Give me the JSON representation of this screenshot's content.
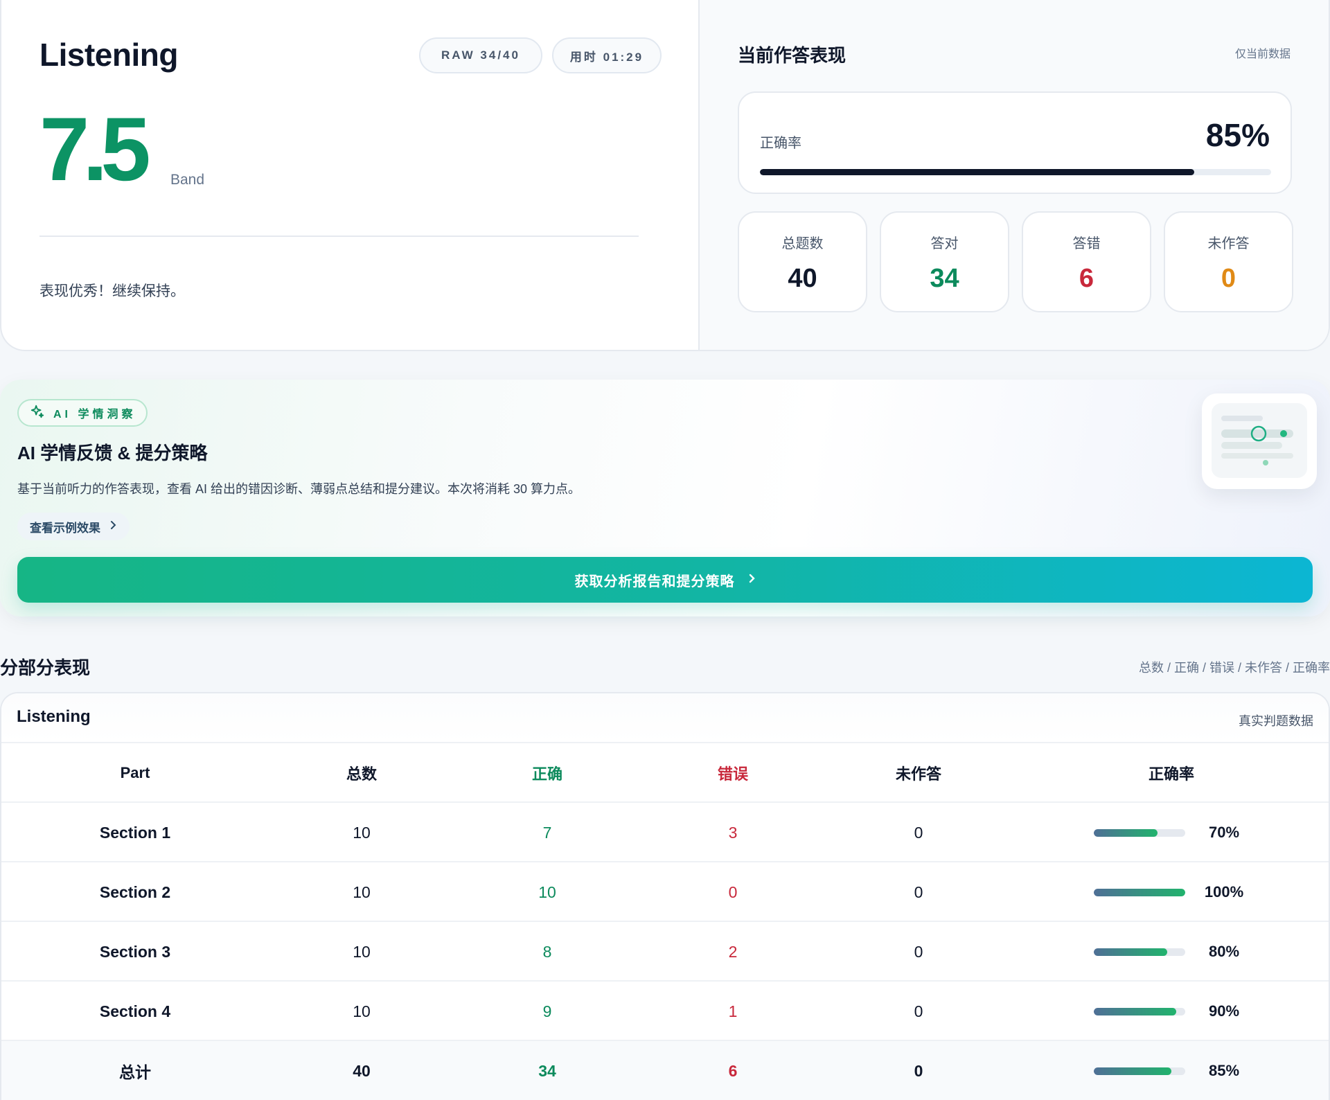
{
  "summary": {
    "module_title": "Listening",
    "raw_pill": "RAW 34/40",
    "time_pill": "用时 01:29",
    "band_score": "7.5",
    "band_label": "Band",
    "comment": "表现优秀！继续保持。"
  },
  "performance": {
    "title": "当前作答表现",
    "note": "仅当前数据",
    "accuracy_label": "正确率",
    "accuracy_text": "85%",
    "accuracy_fraction": 0.85,
    "stats": [
      {
        "label": "总题数",
        "value": "40",
        "color": "#0f172a"
      },
      {
        "label": "答对",
        "value": "34",
        "color": "#0c8a5c"
      },
      {
        "label": "答错",
        "value": "6",
        "color": "#c8283b"
      },
      {
        "label": "未作答",
        "value": "0",
        "color": "#e08a16"
      }
    ]
  },
  "ai": {
    "tag": "AI 学情洞察",
    "title": "AI 学情反馈 & 提分策略",
    "description": "基于当前听力的作答表现，查看 AI 给出的错因诊断、薄弱点总结和提分建议。本次将消耗 30 算力点。",
    "example_label": "查看示例效果",
    "cta_label": "获取分析报告和提分策略"
  },
  "sections": {
    "title": "分部分表现",
    "legend": "总数 / 正确 / 错误 / 未作答 / 正确率",
    "table_name": "Listening",
    "table_note": "真实判题数据",
    "columns": [
      "Part",
      "总数",
      "正确",
      "错误",
      "未作答",
      "正确率"
    ],
    "rows": [
      {
        "part": "Section 1",
        "total": "10",
        "correct": "7",
        "wrong": "3",
        "blank": "0",
        "rate": "70%",
        "rate_fraction": 0.7
      },
      {
        "part": "Section 2",
        "total": "10",
        "correct": "10",
        "wrong": "0",
        "blank": "0",
        "rate": "100%",
        "rate_fraction": 1.0
      },
      {
        "part": "Section 3",
        "total": "10",
        "correct": "8",
        "wrong": "2",
        "blank": "0",
        "rate": "80%",
        "rate_fraction": 0.8
      },
      {
        "part": "Section 4",
        "total": "10",
        "correct": "9",
        "wrong": "1",
        "blank": "0",
        "rate": "90%",
        "rate_fraction": 0.9
      }
    ],
    "total_row": {
      "part": "总计",
      "total": "40",
      "correct": "34",
      "wrong": "6",
      "blank": "0",
      "rate": "85%",
      "rate_fraction": 0.85
    }
  },
  "icons": {
    "ai_tag_icon": "sparkle-icon",
    "example_icon": "chevron-right-icon",
    "cta_icon": "chevron-right-icon"
  },
  "colors": {
    "brand_green": "#0c9364",
    "correct": "#0c8a5c",
    "wrong": "#c8283b",
    "blank": "#e08a16"
  }
}
